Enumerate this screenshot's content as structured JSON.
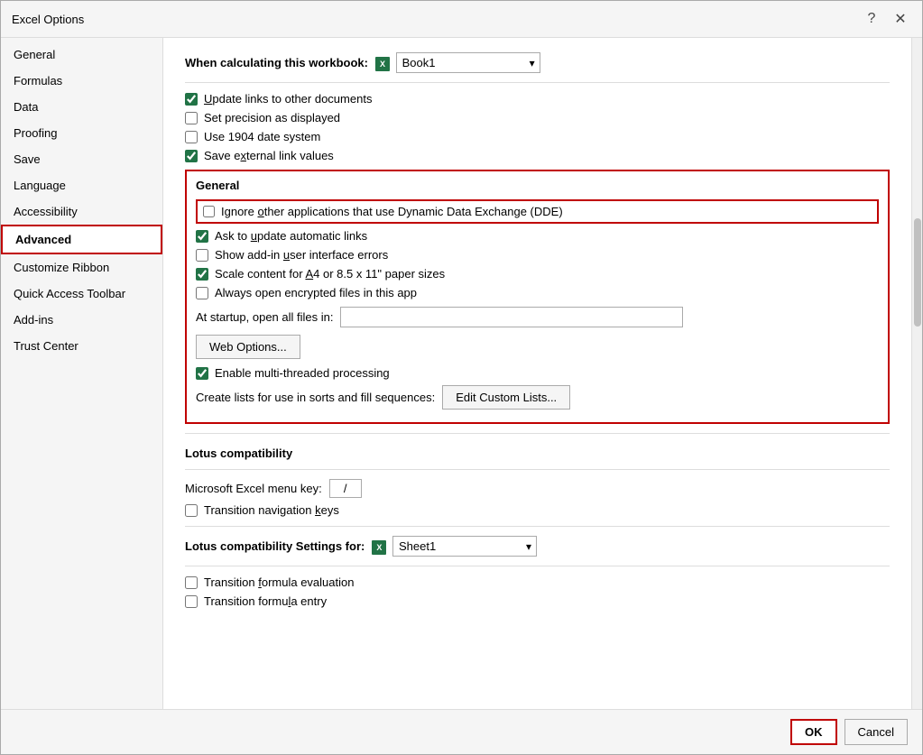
{
  "dialog": {
    "title": "Excel Options",
    "help_btn": "?",
    "close_btn": "✕"
  },
  "sidebar": {
    "items": [
      {
        "label": "General",
        "active": false
      },
      {
        "label": "Formulas",
        "active": false
      },
      {
        "label": "Data",
        "active": false
      },
      {
        "label": "Proofing",
        "active": false
      },
      {
        "label": "Save",
        "active": false
      },
      {
        "label": "Language",
        "active": false
      },
      {
        "label": "Accessibility",
        "active": false
      },
      {
        "label": "Advanced",
        "active": true
      },
      {
        "label": "Customize Ribbon",
        "active": false
      },
      {
        "label": "Quick Access Toolbar",
        "active": false
      },
      {
        "label": "Add-ins",
        "active": false
      },
      {
        "label": "Trust Center",
        "active": false
      }
    ]
  },
  "main": {
    "workbook_section": {
      "label": "When calculating this workbook:",
      "dropdown_value": "Book1",
      "icon": "X"
    },
    "checkboxes1": [
      {
        "id": "cb1",
        "label": "Update links to other documents",
        "checked": true
      },
      {
        "id": "cb2",
        "label": "Set precision as displayed",
        "checked": false
      },
      {
        "id": "cb3",
        "label": "Use 1904 date system",
        "checked": false
      },
      {
        "id": "cb4",
        "label": "Save external link values",
        "checked": true
      }
    ],
    "general_section": {
      "title": "General",
      "dde_label": "Ignore other applications that use Dynamic Data Exchange (DDE)",
      "dde_checked": false,
      "checkboxes": [
        {
          "id": "cb5",
          "label": "Ask to update automatic links",
          "checked": true
        },
        {
          "id": "cb6",
          "label": "Show add-in user interface errors",
          "checked": false
        },
        {
          "id": "cb7",
          "label": "Scale content for A4 or 8.5 x 11\" paper sizes",
          "checked": true
        },
        {
          "id": "cb8",
          "label": "Always open encrypted files in this app",
          "checked": false
        }
      ],
      "startup_label": "At startup, open all files in:",
      "startup_value": "",
      "web_options_btn": "Web Options...",
      "enable_threading_label": "Enable multi-threaded processing",
      "enable_threading_checked": true,
      "create_lists_label": "Create lists for use in sorts and fill sequences:",
      "edit_custom_lists_btn": "Edit Custom Lists..."
    },
    "lotus_section": {
      "title": "Lotus compatibility",
      "menu_key_label": "Microsoft Excel menu key:",
      "menu_key_value": "/",
      "transition_nav_label": "Transition navigation keys",
      "transition_nav_checked": false
    },
    "lotus_settings_section": {
      "label": "Lotus compatibility Settings for:",
      "dropdown_value": "Sheet1",
      "icon": "X",
      "checkboxes": [
        {
          "id": "cb9",
          "label": "Transition formula evaluation",
          "checked": false
        },
        {
          "id": "cb10",
          "label": "Transition formula entry",
          "checked": false
        }
      ]
    }
  },
  "footer": {
    "ok_label": "OK",
    "cancel_label": "Cancel"
  }
}
